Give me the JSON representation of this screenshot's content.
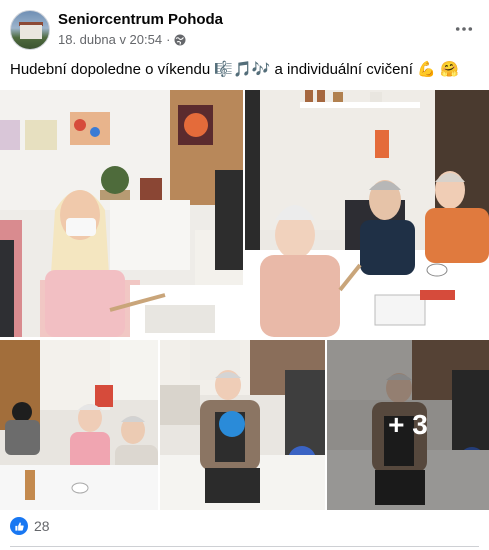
{
  "post": {
    "page_name": "Seniorcentrum Pohoda",
    "date": "18. dubna v 20:54",
    "separator": "·",
    "privacy_icon": "globe-icon",
    "text": "Hudební dopoledne o víkendu 🎼🎵🎶 a individuální cvičení 💪 🤗"
  },
  "gallery": {
    "photos": [
      "woman-in-mask-holding-sticks",
      "seniors-playing-percussion-at-table",
      "seniors-at-table-group",
      "senior-woman-exercising-with-ball",
      "senior-woman-exercising"
    ],
    "more_count": "+ 3"
  },
  "reactions": {
    "icon": "thumbs-up-icon",
    "count": "28",
    "color": "#1877f2"
  }
}
